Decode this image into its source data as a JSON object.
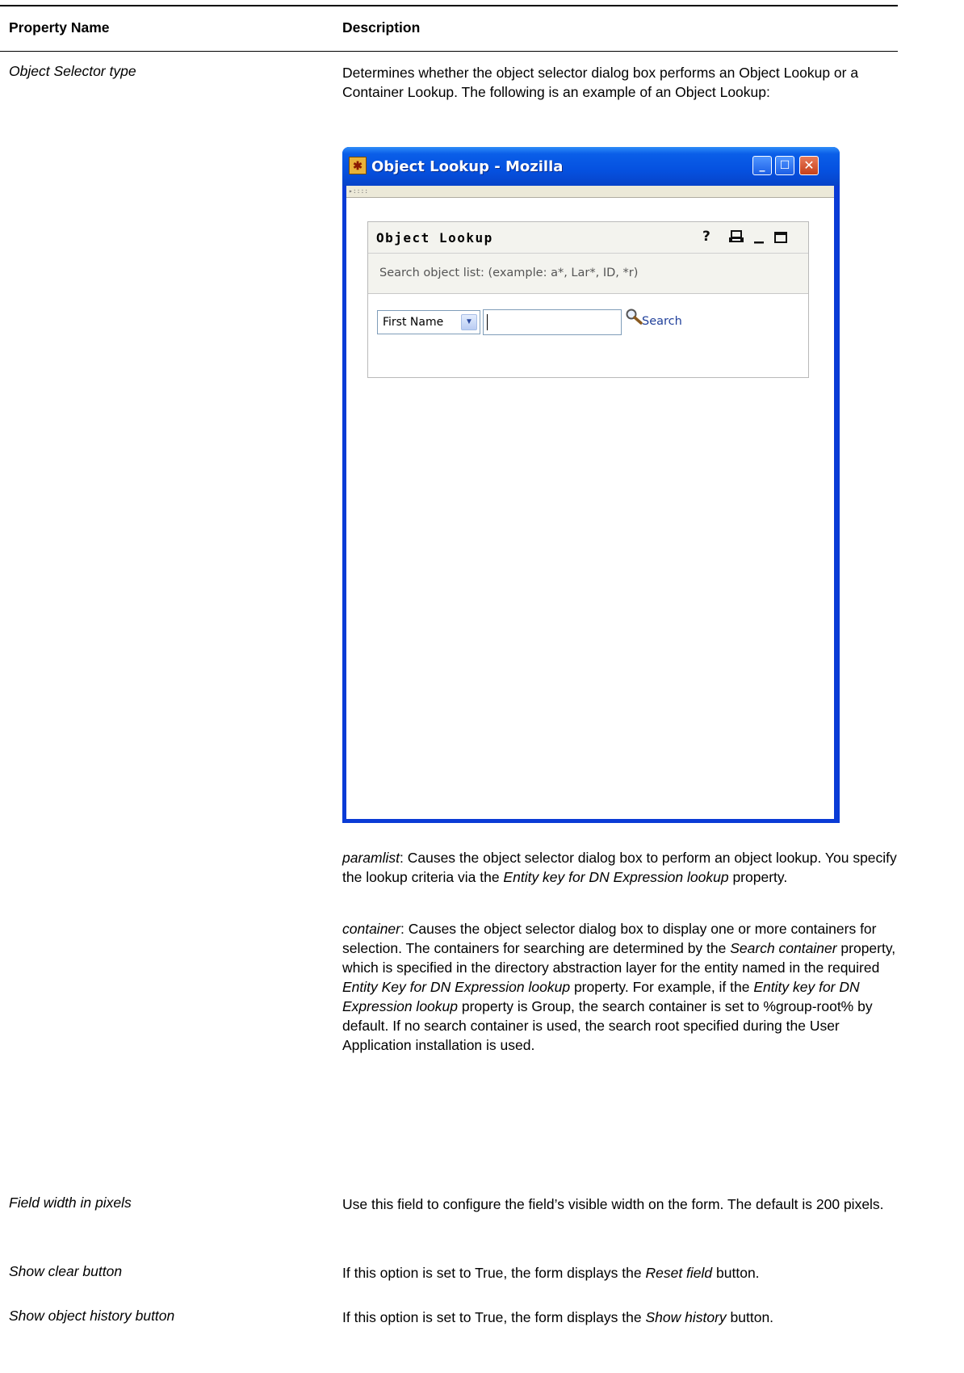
{
  "table": {
    "headers": {
      "property_name": "Property Name",
      "description": "Description"
    },
    "rows": [
      {
        "property": "Object Selector type",
        "description": "Determines whether the object selector dialog box performs an Object Lookup or a Container Lookup. The following is an example of an Object Lookup:",
        "paramlist": {
          "term": "paramlist",
          "text_a": ": Causes the object selector dialog box to perform an object lookup. You specify the lookup criteria via the ",
          "ref": "Entity key for DN Expression lookup",
          "text_b": " property."
        },
        "container": {
          "term": "container",
          "text_a": ":  Causes the object selector dialog box to display one or more containers for selection. The containers for searching are determined by the ",
          "ref1": "Search container",
          "text_b": " property, which is specified in the directory abstraction layer for the entity named in the required ",
          "ref2": "Entity Key for DN Expression lookup",
          "text_c": " property. For example, if the ",
          "ref3": "Entity key for DN Expression lookup",
          "text_d": " property is Group, the search container is set to %group-root% by default. If no search container is used, the search root specified during the User Application installation is used."
        }
      },
      {
        "property": "Field width in pixels",
        "description": "Use this field to configure the field’s visible width on the form. The default is 200 pixels."
      },
      {
        "property": "Show clear button",
        "text_a": "If this option is set to True, the form displays the ",
        "ref": "Reset field",
        "text_b": " button."
      },
      {
        "property": "Show object history button",
        "text_a": "If this option is set to True, the form displays the ",
        "ref": "Show history",
        "text_b": " button."
      }
    ]
  },
  "screenshot": {
    "window_title": "Object Lookup - Mozilla",
    "portlet_title": "Object Lookup",
    "portlet_icons": [
      "help-icon",
      "print-icon",
      "minimize-icon",
      "maximize-icon"
    ],
    "help_glyph": "?",
    "hint": "Search object list: (example: a*, Lar*, ID, *r)",
    "attribute_select": "First Name",
    "search_input_value": "",
    "search_link": "Search",
    "colors": {
      "titlebar": "#0551e0",
      "close_button": "#c6401a",
      "link": "#1f3f9a"
    }
  }
}
